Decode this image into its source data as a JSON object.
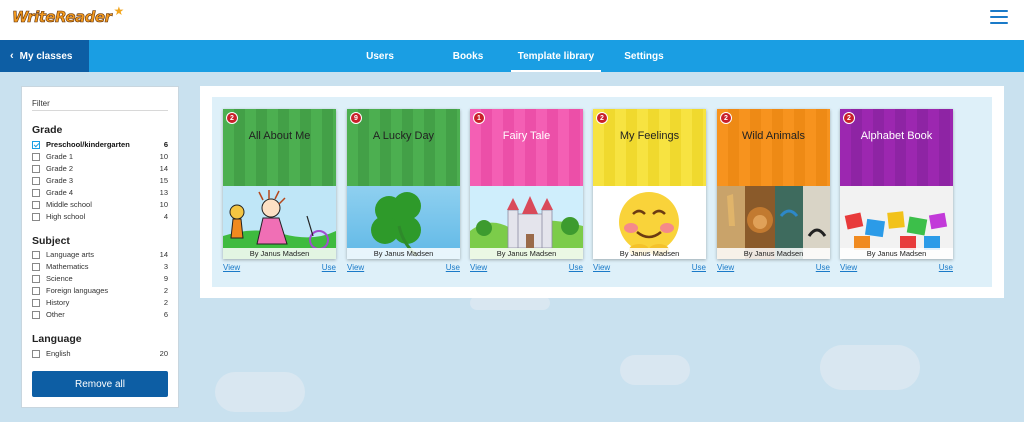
{
  "header": {
    "logo_text": "WriteReader",
    "logo_star": "★"
  },
  "nav": {
    "back_label": "My classes",
    "tabs": [
      {
        "label": "Users"
      },
      {
        "label": "Books"
      },
      {
        "label": "Template library"
      },
      {
        "label": "Settings"
      }
    ]
  },
  "filter": {
    "title": "Filter",
    "groups": [
      {
        "title": "Grade",
        "options": [
          {
            "label": "Preschool/kindergarten",
            "count": "6"
          },
          {
            "label": "Grade 1",
            "count": "10"
          },
          {
            "label": "Grade 2",
            "count": "14"
          },
          {
            "label": "Grade 3",
            "count": "15"
          },
          {
            "label": "Grade 4",
            "count": "13"
          },
          {
            "label": "Middle school",
            "count": "10"
          },
          {
            "label": "High school",
            "count": "4"
          }
        ]
      },
      {
        "title": "Subject",
        "options": [
          {
            "label": "Language arts",
            "count": "14"
          },
          {
            "label": "Mathematics",
            "count": "3"
          },
          {
            "label": "Science",
            "count": "9"
          },
          {
            "label": "Foreign languages",
            "count": "2"
          },
          {
            "label": "History",
            "count": "2"
          },
          {
            "label": "Other",
            "count": "6"
          }
        ]
      },
      {
        "title": "Language",
        "options": [
          {
            "label": "English",
            "count": "20"
          }
        ]
      }
    ],
    "remove_all_label": "Remove all"
  },
  "books": [
    {
      "title": "All About Me",
      "badge": "2",
      "author": "By Janus Madsen",
      "view": "View",
      "use": "Use",
      "color": "#4caf50",
      "stripe": "#43a047"
    },
    {
      "title": "A Lucky Day",
      "badge": "9",
      "author": "By Janus Madsen",
      "view": "View",
      "use": "Use",
      "color": "#4caf50",
      "stripe": "#43a047"
    },
    {
      "title": "Fairy Tale",
      "badge": "1",
      "author": "By Janus Madsen",
      "view": "View",
      "use": "Use",
      "color": "#f45fb4",
      "stripe": "#ec4fa8"
    },
    {
      "title": "My Feelings",
      "badge": "2",
      "author": "By Janus Madsen",
      "view": "View",
      "use": "Use",
      "color": "#f7e341",
      "stripe": "#f0d92e"
    },
    {
      "title": "Wild Animals",
      "badge": "2",
      "author": "By Janus Madsen",
      "view": "View",
      "use": "Use",
      "color": "#f7931e",
      "stripe": "#ee8a15"
    },
    {
      "title": "Alphabet Book",
      "badge": "2",
      "author": "By Janus Madsen",
      "view": "View",
      "use": "Use",
      "color": "#9c27b0",
      "stripe": "#8e24a4"
    }
  ]
}
